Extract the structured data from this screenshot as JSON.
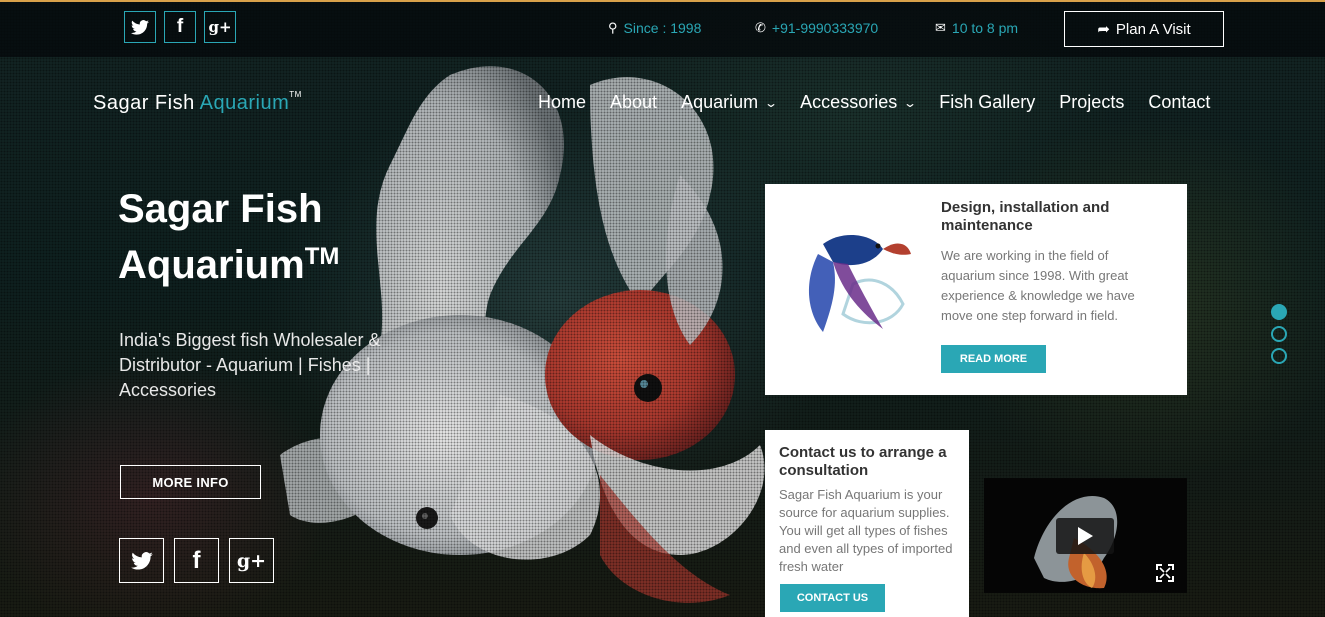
{
  "topbar": {
    "social": [
      {
        "icon": "twitter-icon",
        "glyph": "🐦"
      },
      {
        "icon": "facebook-icon",
        "glyph": "f"
      },
      {
        "icon": "google-plus-icon",
        "glyph": "g+"
      }
    ],
    "since": "Since : 1998",
    "phone": "+91-9990333970",
    "hours": "10 to 8 pm",
    "plan_visit": "Plan A Visit"
  },
  "logo": {
    "part1": "Sagar Fish ",
    "part2": "Aquarium",
    "tm": "TM"
  },
  "nav": {
    "home": "Home",
    "about": "About",
    "aquarium": "Aquarium",
    "accessories": "Accessories",
    "fish_gallery": "Fish Gallery",
    "projects": "Projects",
    "contact": "Contact"
  },
  "hero": {
    "title": "Sagar Fish Aquarium",
    "title_tm": "TM",
    "subtitle": "India's Biggest fish Wholesaler & Distributor - Aquarium | Fishes | Accessories",
    "more_info": "MORE INFO"
  },
  "service_card": {
    "title": "Design, installation and maintenance",
    "text": "We are working in the field of aquarium since 1998. With great experience & knowledge we have move one step forward in field.",
    "button": "READ MORE"
  },
  "contact_card": {
    "title": "Contact us to arrange a consultation",
    "text": "Sagar Fish Aquarium is your source for aquarium supplies. You will get all types of fishes and even all types of imported fresh water",
    "button": "CONTACT US"
  },
  "slider": {
    "slide_count": 3,
    "active_slide": 1
  },
  "colors": {
    "accent": "#2aa7b5",
    "topbar_line": "#d8a14a"
  }
}
